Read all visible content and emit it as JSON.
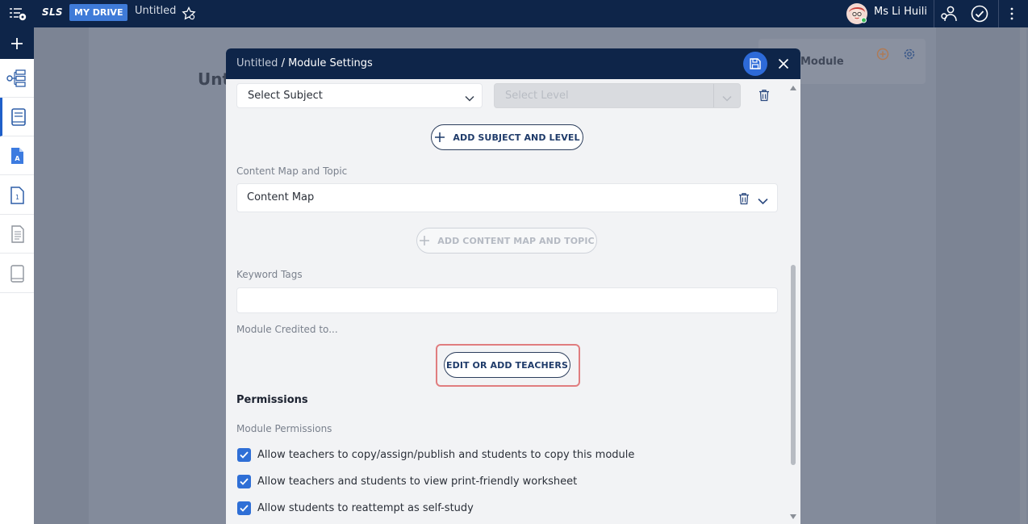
{
  "topbar": {
    "logo": "SLS",
    "drive_badge": "MY DRIVE",
    "doc_title": "Untitled",
    "user_name": "Ms Li Huili"
  },
  "background": {
    "page_title": "Unt",
    "card_title": "Module"
  },
  "modal": {
    "breadcrumb_parent": "Untitled",
    "breadcrumb_sep": " / ",
    "breadcrumb_current": "Module Settings",
    "subject_select": "Select Subject",
    "level_select": "Select Level",
    "add_subject_level": "ADD SUBJECT AND LEVEL",
    "content_map_label": "Content Map and Topic",
    "content_map_value": "Content Map",
    "add_content_map": "ADD CONTENT MAP AND TOPIC",
    "keyword_label": "Keyword Tags",
    "keyword_value": "",
    "credited_label": "Module Credited to...",
    "edit_teachers": "EDIT OR ADD TEACHERS",
    "permissions_title": "Permissions",
    "module_permissions_label": "Module Permissions",
    "permissions": [
      {
        "label": "Allow teachers to copy/assign/publish and students to copy this module",
        "checked": true
      },
      {
        "label": "Allow teachers and students to view print-friendly worksheet",
        "checked": true
      },
      {
        "label": "Allow students to reattempt as self-study",
        "checked": true
      }
    ]
  },
  "colors": {
    "navy": "#0e2549",
    "accent_blue": "#2f6fd6",
    "highlight_red": "#e07d7f"
  }
}
